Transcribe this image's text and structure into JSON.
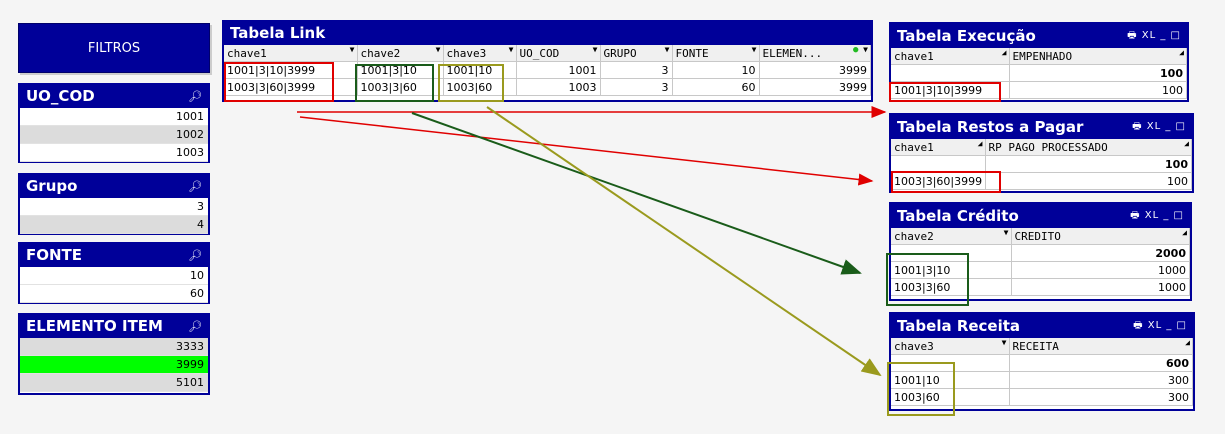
{
  "filters": {
    "title": "FILTROS",
    "uo_cod": {
      "title": "UO_COD",
      "items": [
        "1001",
        "1002",
        "1003"
      ]
    },
    "grupo": {
      "title": "Grupo",
      "items": [
        "3",
        "4"
      ]
    },
    "fonte": {
      "title": "FONTE",
      "items": [
        "10",
        "60"
      ]
    },
    "elemento": {
      "title": "ELEMENTO ITEM",
      "items": [
        "3333",
        "3999",
        "5101"
      ],
      "selected": "3999"
    }
  },
  "link": {
    "title": "Tabela Link",
    "headers": [
      "chave1",
      "chave2",
      "chave3",
      "UO_COD",
      "GRUPO",
      "FONTE",
      "ELEMEN..."
    ],
    "rows": [
      [
        "1001|3|10|3999",
        "1001|3|10",
        "1001|10",
        "1001",
        "3",
        "10",
        "3999"
      ],
      [
        "1003|3|60|3999",
        "1003|3|60",
        "1003|60",
        "1003",
        "3",
        "60",
        "3999"
      ]
    ]
  },
  "execucao": {
    "title": "Tabela Execução",
    "controls": "XL _ □",
    "headers": [
      "chave1",
      "EMPENHADO"
    ],
    "total": "100",
    "rows": [
      [
        "1001|3|10|3999",
        "100"
      ]
    ]
  },
  "restos": {
    "title": "Tabela Restos a Pagar",
    "controls": "XL _ □",
    "headers": [
      "chave1",
      "RP PAGO PROCESSADO"
    ],
    "total": "100",
    "rows": [
      [
        "1003|3|60|3999",
        "100"
      ]
    ]
  },
  "credito": {
    "title": "Tabela Crédito",
    "controls": "XL _ □",
    "headers": [
      "chave2",
      "CREDITO"
    ],
    "total": "2000",
    "rows": [
      [
        "1001|3|10",
        "1000"
      ],
      [
        "1003|3|60",
        "1000"
      ]
    ]
  },
  "receita": {
    "title": "Tabela Receita",
    "controls": "XL _ □",
    "headers": [
      "chave3",
      "RECEITA"
    ],
    "total": "600",
    "rows": [
      [
        "1001|10",
        "300"
      ],
      [
        "1003|60",
        "300"
      ]
    ]
  },
  "colors": {
    "brand": "#000099",
    "selected": "#00ff00",
    "red": "#e00000",
    "green": "#1a5c1a",
    "olive": "#9a9a1e"
  }
}
